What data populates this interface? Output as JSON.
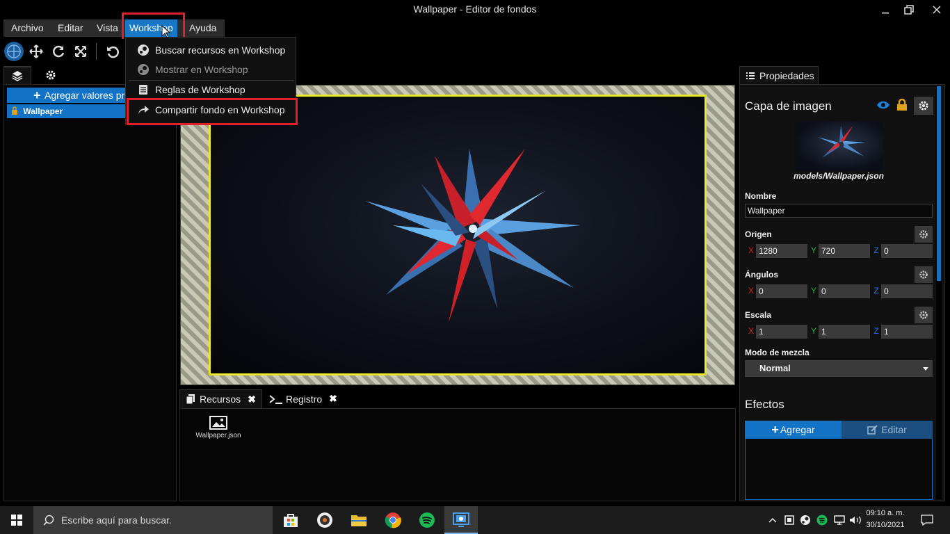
{
  "window": {
    "title": "Wallpaper - Editor de fondos"
  },
  "menubar": {
    "items": [
      "Archivo",
      "Editar",
      "Vista",
      "Workshop",
      "Ayuda"
    ],
    "active": "Workshop"
  },
  "workshop_menu": [
    {
      "label": "Buscar recursos en Workshop",
      "icon": "steam-icon",
      "enabled": true
    },
    {
      "label": "Mostrar en Workshop",
      "icon": "steam-icon",
      "enabled": false
    },
    {
      "label": "Reglas de Workshop",
      "icon": "document-icon",
      "enabled": true
    },
    {
      "label": "Compartir fondo en Workshop",
      "icon": "share-arrow-icon",
      "enabled": true
    }
  ],
  "left_panel": {
    "add_button": "Agregar valores pr",
    "layer": "Wallpaper"
  },
  "bottom_tabs": [
    {
      "label": "Recursos",
      "icon": "files-icon"
    },
    {
      "label": "Registro",
      "icon": "terminal-icon"
    }
  ],
  "assets": [
    {
      "name": "Wallpaper.json",
      "icon": "image-icon"
    }
  ],
  "properties": {
    "tab": "Propiedades",
    "section_title": "Capa de imagen",
    "model_path": "models/Wallpaper.json",
    "name_label": "Nombre",
    "name_value": "Wallpaper",
    "origin_label": "Origen",
    "origin": {
      "x": "1280",
      "y": "720",
      "z": "0"
    },
    "angles_label": "Ángulos",
    "angles": {
      "x": "0",
      "y": "0",
      "z": "0"
    },
    "scale_label": "Escala",
    "scale": {
      "x": "1",
      "y": "1",
      "z": "1"
    },
    "blend_label": "Modo de mezcla",
    "blend_value": "Normal",
    "effects_label": "Efectos",
    "effects_add": "Agregar",
    "effects_edit": "Editar",
    "axis": {
      "x": "X",
      "y": "Y",
      "z": "Z"
    }
  },
  "taskbar": {
    "search_placeholder": "Escribe aquí para buscar.",
    "time": "09:10 a. m.",
    "date": "30/10/2021"
  },
  "colors": {
    "accent": "#1272c6",
    "highlight": "#e0202a",
    "canvas_border": "#e8e826"
  }
}
